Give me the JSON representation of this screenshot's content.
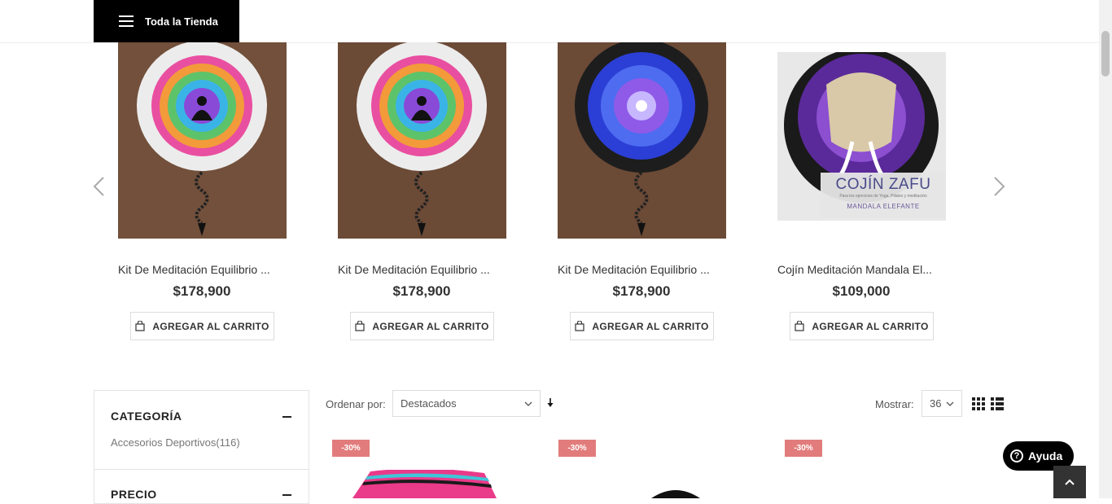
{
  "header": {
    "store_button_label": "Toda la Tienda"
  },
  "carousel": {
    "products": [
      {
        "name": "Kit De Meditación Equilibrio ...",
        "price": "$178,900",
        "cart_label": "AGREGAR AL CARRITO"
      },
      {
        "name": "Kit De Meditación Equilibrio ...",
        "price": "$178,900",
        "cart_label": "AGREGAR AL CARRITO"
      },
      {
        "name": "Kit De Meditación Equilibrio ...",
        "price": "$178,900",
        "cart_label": "AGREGAR AL CARRITO"
      },
      {
        "name": "Cojín Meditación Mandala El...",
        "price": "$109,000",
        "cart_label": "AGREGAR AL CARRITO",
        "image_text": {
          "title": "COJÍN ZAFU",
          "subtitle": "Para los ejercicios de Yoga, Pilates y meditación",
          "caption": "MANDALA ELEFANTE"
        }
      }
    ]
  },
  "sidebar": {
    "category_title": "CATEGORÍA",
    "category_item": "Accesorios Deportivos(116)",
    "price_title": "PRECIO"
  },
  "toolbar": {
    "sort_label": "Ordenar por:",
    "sort_value": "Destacados",
    "show_label": "Mostrar:",
    "show_value": "36"
  },
  "grid": {
    "badges": [
      "-30%",
      "-30%",
      "-30%"
    ]
  },
  "help_button_label": "Ayuda",
  "colors": {
    "badge": "#e27c7c",
    "dark": "#000000"
  }
}
